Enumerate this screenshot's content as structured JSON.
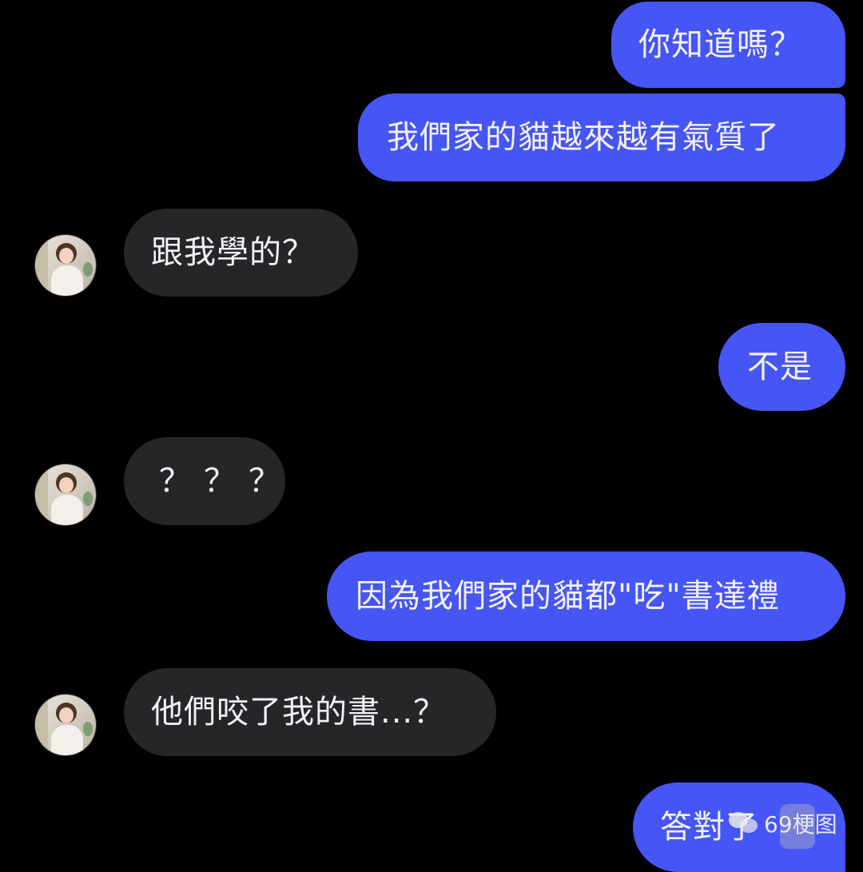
{
  "conversation": {
    "messages": [
      {
        "id": "m1",
        "sender": "me",
        "text": "你知道嗎？"
      },
      {
        "id": "m2",
        "sender": "me",
        "text": "我們家的貓越來越有氣質了"
      },
      {
        "id": "m3",
        "sender": "friend",
        "text": "跟我學的？"
      },
      {
        "id": "m4",
        "sender": "me",
        "text": "不是"
      },
      {
        "id": "m5",
        "sender": "friend",
        "text": "？？？"
      },
      {
        "id": "m6",
        "sender": "me",
        "text": "因為我們家的貓都\"吃\"書達禮"
      },
      {
        "id": "m7",
        "sender": "friend",
        "text": "他們咬了我的書...？"
      },
      {
        "id": "m8",
        "sender": "me",
        "text": "答對了"
      }
    ]
  },
  "watermark": {
    "text": "69梗图",
    "icon": "wechat-icon"
  },
  "colors": {
    "background": "#000000",
    "outgoing_bubble": "#4655f5",
    "incoming_bubble": "#262628",
    "text": "#f2f2f7"
  }
}
